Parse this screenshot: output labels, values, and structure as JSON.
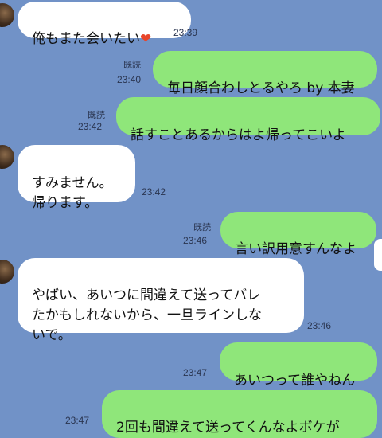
{
  "chat": {
    "messages": [
      {
        "side": "in",
        "text": "俺もまた会いたい",
        "emoji": "❤",
        "time": "23:39"
      },
      {
        "side": "out",
        "text": "毎日顔合わしとるやろ by 本妻",
        "time": "23:40",
        "read": "既読"
      },
      {
        "side": "out",
        "text": "話すことあるからはよ帰ってこいよ",
        "time": "23:42",
        "read": "既読"
      },
      {
        "side": "in",
        "text": "すみません。\n帰ります。",
        "time": "23:42"
      },
      {
        "side": "out",
        "text": "言い訳用意すんなよ",
        "time": "23:46",
        "read": "既読"
      },
      {
        "side": "in",
        "text": "やばい、あいつに間違えて送ってバレ\nたかもしれないから、一旦ラインしな\nいで。",
        "time": "23:46"
      },
      {
        "side": "out",
        "text": "あいつって誰やねん",
        "time": "23:47"
      },
      {
        "side": "out",
        "text": "2回も間違えて送ってくんなよボケが",
        "time": "23:47"
      }
    ]
  },
  "colors": {
    "background": "#7192c7",
    "incoming_bubble": "#ffffff",
    "outgoing_bubble": "#8fe67a",
    "heart": "#e8452a"
  }
}
